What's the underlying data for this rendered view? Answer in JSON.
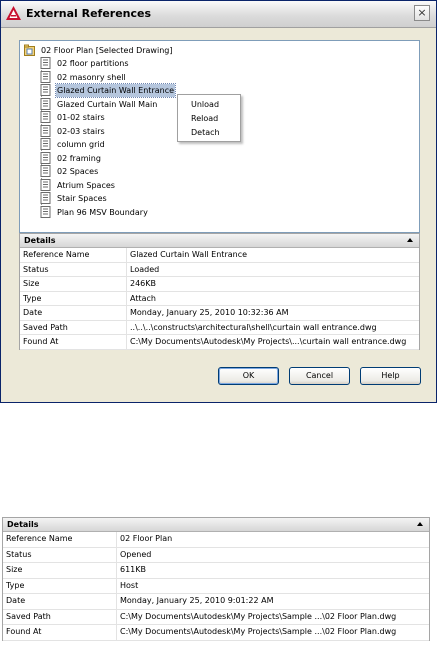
{
  "window": {
    "title": "External References",
    "close_label": "×"
  },
  "tree": {
    "root": "02 Floor Plan [Selected Drawing]",
    "items": [
      {
        "label": "02 floor partitions"
      },
      {
        "label": "02 masonry shell"
      },
      {
        "label": "Glazed Curtain Wall Entrance",
        "selected": true
      },
      {
        "label": "Glazed Curtain Wall Main"
      },
      {
        "label": "01-02 stairs"
      },
      {
        "label": "02-03 stairs"
      },
      {
        "label": "column grid"
      },
      {
        "label": "02 framing"
      },
      {
        "label": "02 Spaces"
      },
      {
        "label": "Atrium Spaces"
      },
      {
        "label": "Stair Spaces"
      },
      {
        "label": "Plan 96 MSV Boundary"
      }
    ]
  },
  "context_menu": {
    "items": [
      "Unload",
      "Reload",
      "Detach"
    ]
  },
  "details_top": {
    "title": "Details",
    "rows": [
      {
        "name": "Reference Name",
        "value": "Glazed Curtain Wall Entrance"
      },
      {
        "name": "Status",
        "value": "Loaded"
      },
      {
        "name": "Size",
        "value": "246KB"
      },
      {
        "name": "Type",
        "value": "Attach"
      },
      {
        "name": "Date",
        "value": "Monday, January 25, 2010  10:32:36 AM"
      },
      {
        "name": "Saved Path",
        "value": "..\\..\\..\\constructs\\architectural\\shell\\curtain wall entrance.dwg"
      },
      {
        "name": "Found At",
        "value": "C:\\My Documents\\Autodesk\\My Projects\\...\\curtain wall entrance.dwg"
      }
    ]
  },
  "buttons": {
    "ok": "OK",
    "cancel": "Cancel",
    "help": "Help"
  },
  "details_bottom": {
    "title": "Details",
    "rows": [
      {
        "name": "Reference Name",
        "value": "02 Floor Plan"
      },
      {
        "name": "Status",
        "value": "Opened"
      },
      {
        "name": "Size",
        "value": "611KB"
      },
      {
        "name": "Type",
        "value": "Host"
      },
      {
        "name": "Date",
        "value": "Monday, January 25, 2010  9:01:22 AM"
      },
      {
        "name": "Saved Path",
        "value": "C:\\My Documents\\Autodesk\\My Projects\\Sample ...\\02 Floor Plan.dwg"
      },
      {
        "name": "Found At",
        "value": "C:\\My Documents\\Autodesk\\My Projects\\Sample ...\\02 Floor Plan.dwg"
      }
    ]
  },
  "colors": {
    "selection": "#b5c6dd",
    "button_border": "#003c74",
    "dialog_background": "#ece9d8"
  }
}
